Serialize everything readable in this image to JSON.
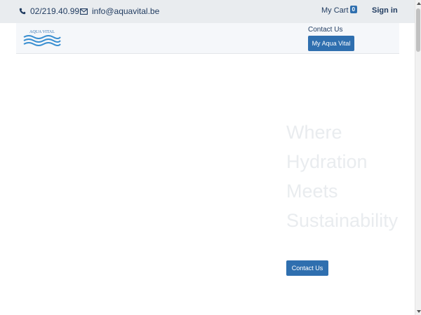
{
  "topbar": {
    "phone": "02/219.40.99",
    "email": "info@aquavital.be",
    "cart_label": "My Cart",
    "cart_count": "0",
    "signin_label": "Sign in",
    "icons": {
      "phone": "phone-icon",
      "email": "envelope-icon"
    }
  },
  "navbar": {
    "logo_text": "AQUA VITAL",
    "contact_link": "Contact Us",
    "my_account_button": "My Aqua Vital"
  },
  "hero": {
    "title_lines": [
      "Where",
      "Hydration",
      "Meets",
      "Sustainability"
    ],
    "cta_button": "Contact Us"
  },
  "colors": {
    "brand_blue": "#2f6faf",
    "text_dark": "#1f3a5f",
    "topbar_bg": "#e9ecef",
    "hero_text": "#e9ecef"
  }
}
